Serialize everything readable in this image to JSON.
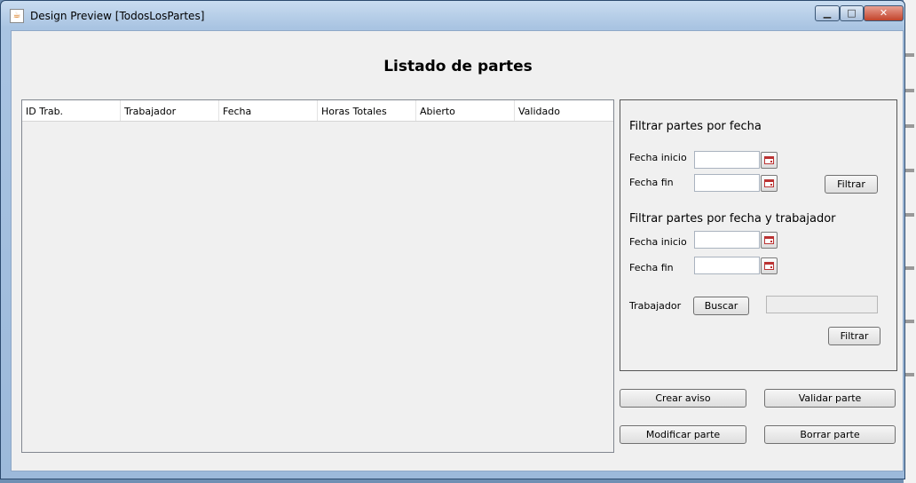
{
  "window": {
    "title": "Design Preview [TodosLosPartes]",
    "controls": {
      "minimize": "▁",
      "maximize": "□",
      "close": "✕"
    }
  },
  "page": {
    "heading": "Listado de partes"
  },
  "table": {
    "columns": [
      "ID Trab.",
      "Trabajador",
      "Fecha",
      "Horas Totales",
      "Abierto",
      "Validado"
    ],
    "rows": []
  },
  "filter_by_date": {
    "title": "Filtrar partes por fecha",
    "start_label": "Fecha inicio",
    "end_label": "Fecha fin",
    "start_value": "",
    "end_value": "",
    "filter_button": "Filtrar"
  },
  "filter_by_date_worker": {
    "title": "Filtrar partes por fecha y trabajador",
    "start_label": "Fecha inicio",
    "end_label": "Fecha fin",
    "start_value": "",
    "end_value": "",
    "worker_label": "Trabajador",
    "search_button": "Buscar",
    "worker_value": "",
    "filter_button": "Filtrar"
  },
  "actions": {
    "create_notice": "Crear aviso",
    "validate_part": "Validar parte",
    "modify_part": "Modificar parte",
    "delete_part": "Borrar parte"
  }
}
